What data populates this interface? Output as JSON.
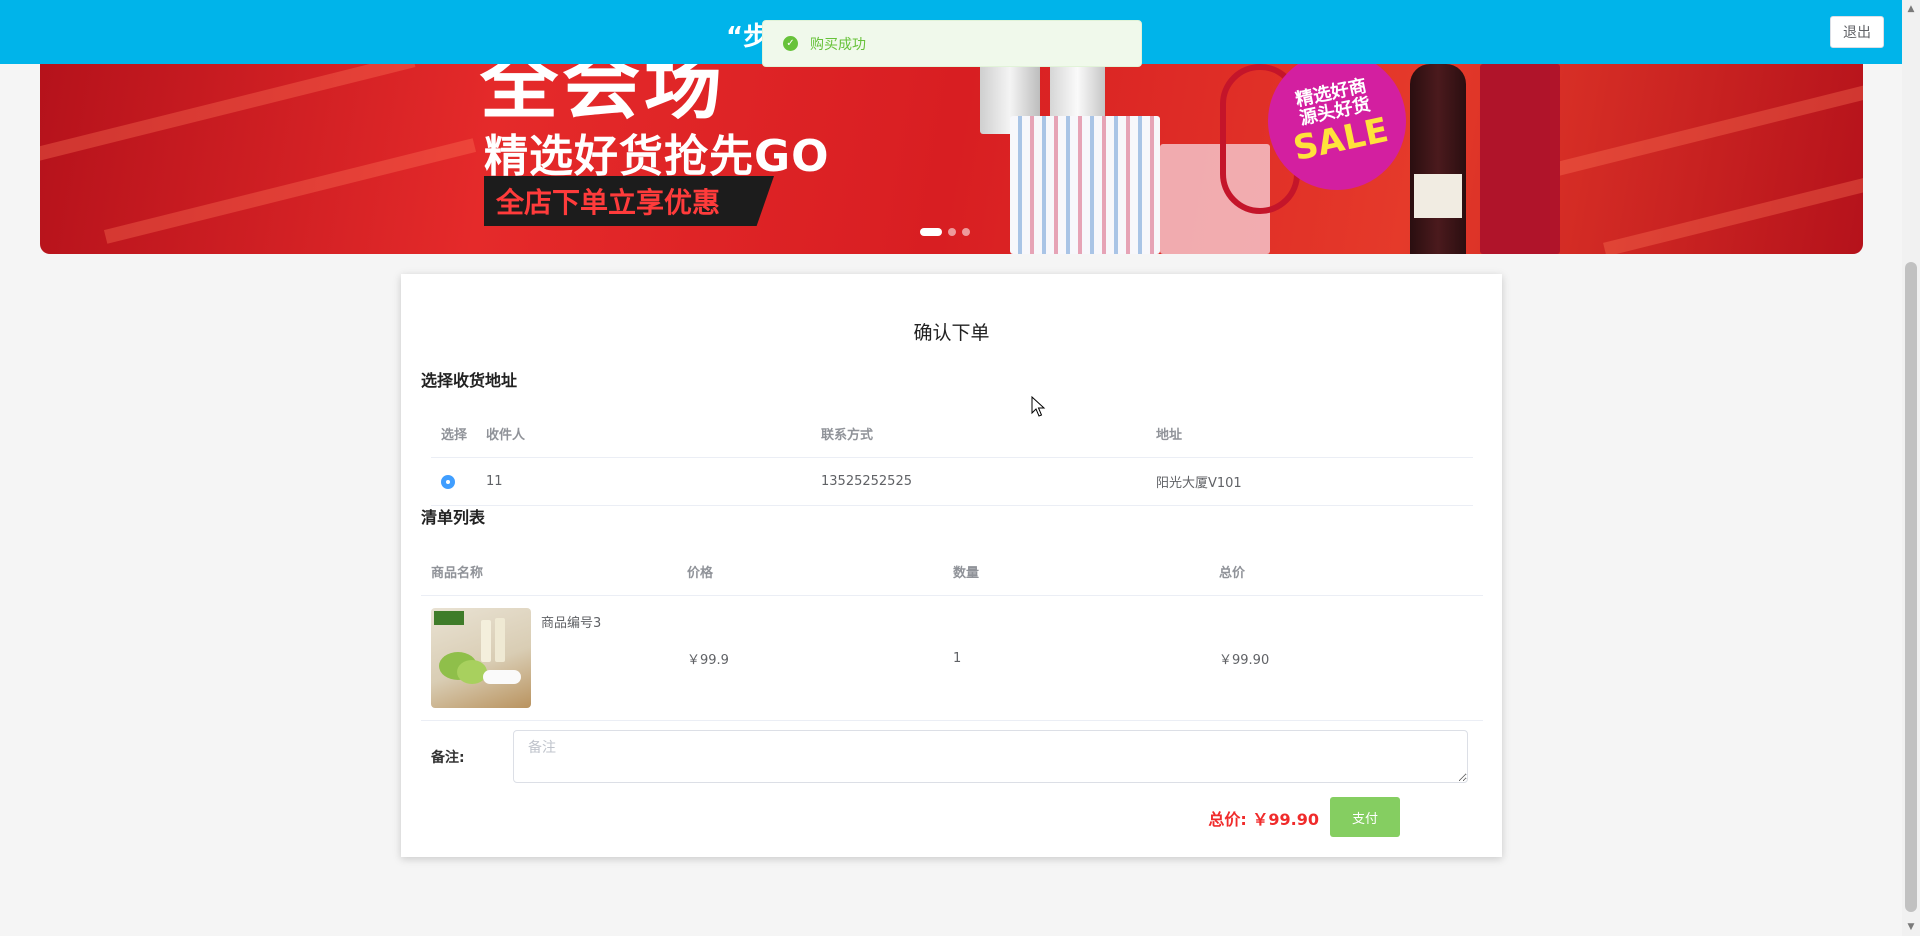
{
  "header": {
    "site_title": "“步",
    "logout_label": "退出"
  },
  "toast": {
    "message": "购买成功",
    "icon": "check-circle-icon"
  },
  "banner": {
    "headline_big": "全会场",
    "headline": "精选好货抢先GO",
    "promo": "全店下单立享优惠",
    "badge_line1": "精选好商",
    "badge_line2": "源头好货",
    "badge_line3": "SALE",
    "slide_count": 3,
    "active_slide": 1
  },
  "order": {
    "title": "确认下单",
    "address_section_title": "选择收货地址",
    "address_columns": [
      "选择",
      "收件人",
      "联系方式",
      "地址"
    ],
    "addresses": [
      {
        "selected": true,
        "name": "11",
        "phone": "13525252525",
        "address": "阳光大厦V101"
      }
    ],
    "items_section_title": "清单列表",
    "item_columns": [
      "商品名称",
      "价格",
      "数量",
      "总价"
    ],
    "items": [
      {
        "name": "商品编号3",
        "price": "￥99.9",
        "quantity": "1",
        "total": "￥99.90"
      }
    ],
    "note_label": "备注:",
    "note_placeholder": "备注",
    "note_value": "",
    "total_text": "总价: ￥99.90",
    "pay_label": "支付"
  },
  "colors": {
    "header_bg": "#00b4ea",
    "toast_text": "#67c23a",
    "total_red": "#f02b2b",
    "pay_button": "#85ce61",
    "radio_blue": "#409eff"
  }
}
